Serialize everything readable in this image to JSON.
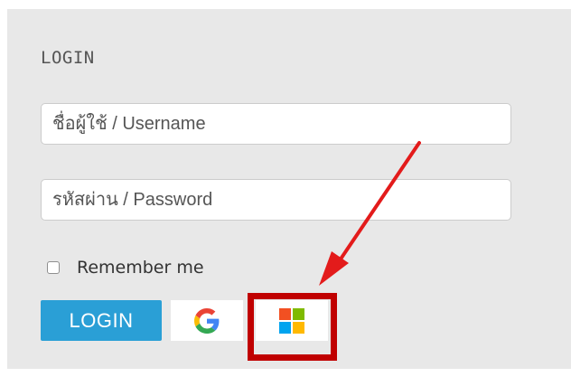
{
  "login": {
    "title": "LOGIN",
    "username_placeholder": "ชื่อผู้ใช้ / Username",
    "password_placeholder": "รหัสผ่าน / Password",
    "remember_label": "Remember me",
    "login_button_label": "LOGIN"
  },
  "icons": {
    "google": "google-logo-icon",
    "microsoft": "microsoft-logo-icon",
    "checkbox": "checkbox-unchecked"
  },
  "colors": {
    "panel_background": "#e8e8e8",
    "login_button": "#2a9fd6",
    "annotation": "#e31b1b",
    "highlight_box": "#c00000",
    "google_blue": "#4285f4",
    "google_red": "#ea4335",
    "google_yellow": "#fbbc05",
    "google_green": "#34a853",
    "ms_red": "#f25022",
    "ms_green": "#7fba00",
    "ms_blue": "#00a4ef",
    "ms_yellow": "#ffb900"
  }
}
